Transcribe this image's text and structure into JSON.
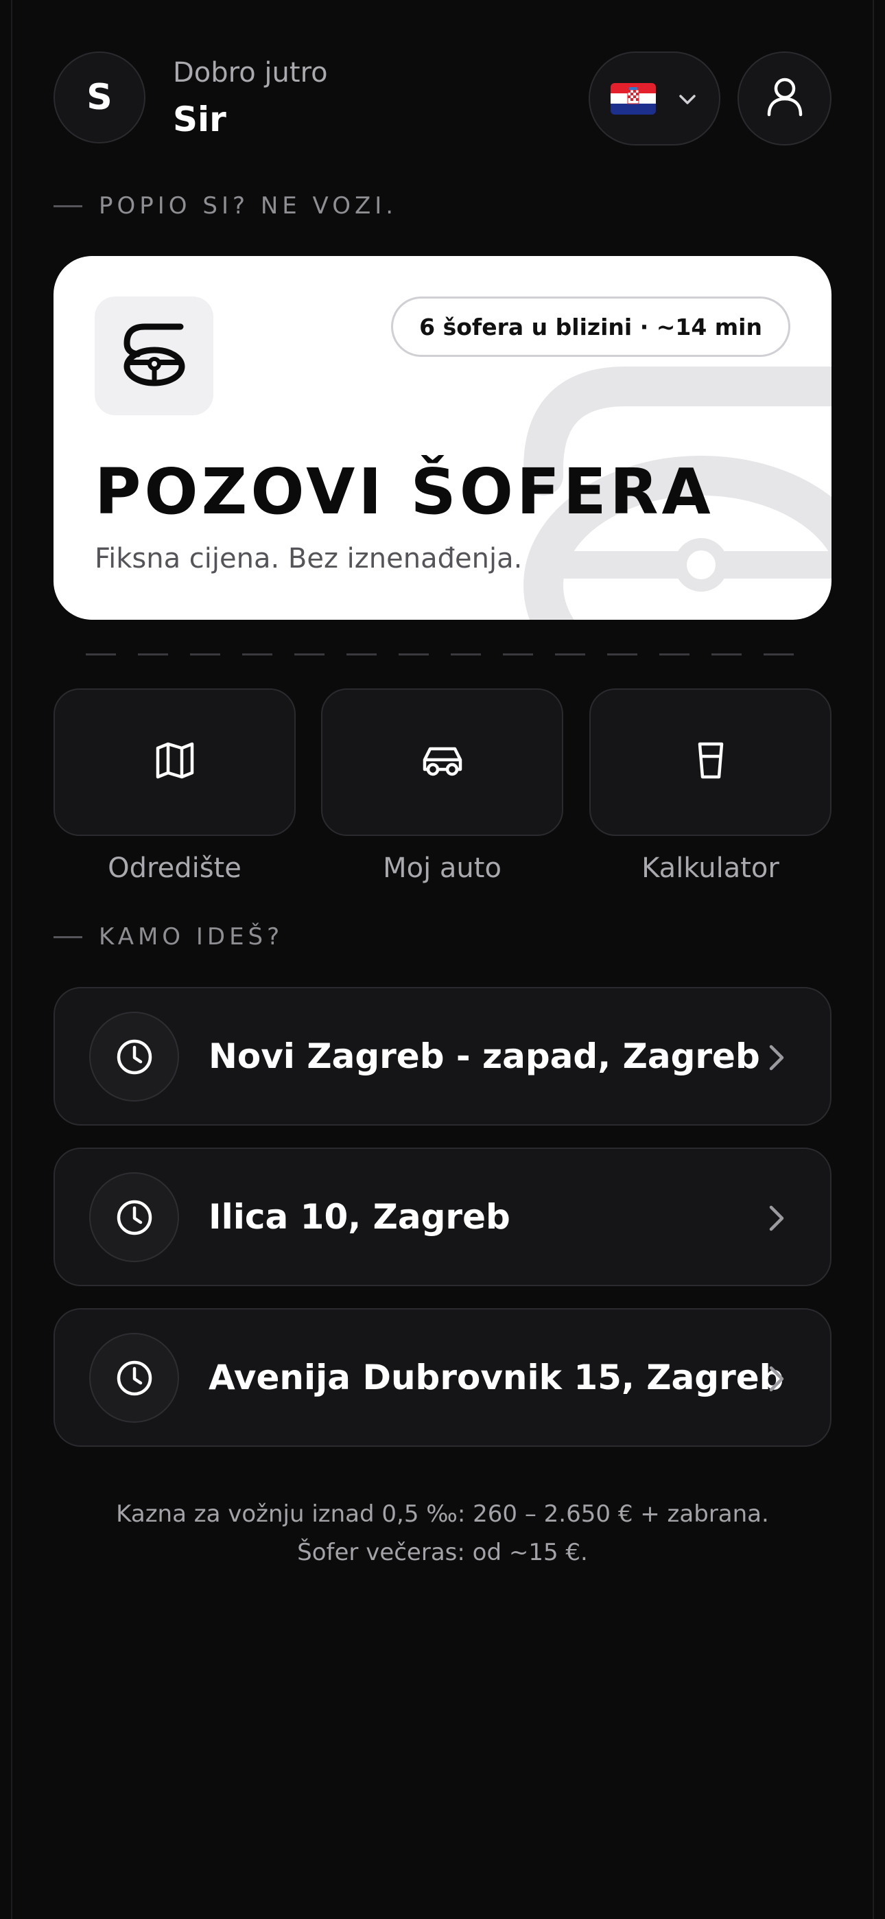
{
  "header": {
    "avatar_initial": "S",
    "greeting": "Dobro jutro",
    "username": "Sir",
    "language_flag_icon": "croatia-flag-icon",
    "profile_icon": "user-icon"
  },
  "sections": {
    "intro_label": "POPIO SI? NE VOZI.",
    "destinations_label": "KAMO IDEŠ?"
  },
  "hero": {
    "badge": "6 šofera u blizini · ~14 min",
    "title": "POZOVI ŠOFERA",
    "subtitle": "Fiksna cijena. Bez iznenađenja.",
    "logo_icon": "steering-wheel-s-logo"
  },
  "quick_actions": [
    {
      "label": "Odredište",
      "icon": "map-icon"
    },
    {
      "label": "Moj auto",
      "icon": "car-icon"
    },
    {
      "label": "Kalkulator",
      "icon": "glass-icon"
    }
  ],
  "recent_destinations": [
    {
      "address": "Novi Zagreb - zapad, Zagreb",
      "icon": "clock-icon"
    },
    {
      "address": "Ilica 10, Zagreb",
      "icon": "clock-icon"
    },
    {
      "address": "Avenija Dubrovnik 15, Zagreb",
      "icon": "clock-icon"
    }
  ],
  "footnote": "Kazna za vožnju iznad 0,5 ‰: 260 – 2.650 € + zabrana. Šofer večeras: od ~15 €.",
  "colors": {
    "background": "#0b0b0c",
    "card": "#151517",
    "hero_card": "#ffffff",
    "muted_text": "#8e8e93"
  }
}
